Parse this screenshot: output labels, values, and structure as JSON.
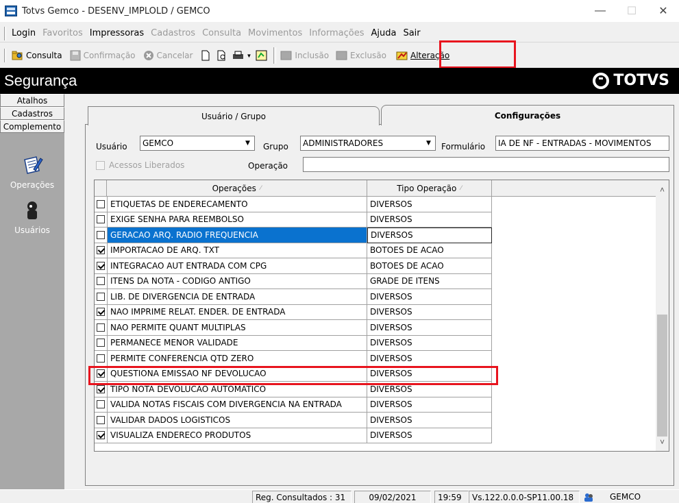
{
  "window": {
    "title": "Totvs Gemco - DESENV_IMPLOLD / GEMCO",
    "minimize": "—",
    "maximize": "☐",
    "close": "✕"
  },
  "menu": [
    {
      "label": "Login",
      "enabled": true
    },
    {
      "label": "Favoritos",
      "enabled": false
    },
    {
      "label": "Impressoras",
      "enabled": true
    },
    {
      "label": "Cadastros",
      "enabled": false
    },
    {
      "label": "Consulta",
      "enabled": false
    },
    {
      "label": "Movimentos",
      "enabled": false
    },
    {
      "label": "Informações",
      "enabled": false
    },
    {
      "label": "Ajuda",
      "enabled": true
    },
    {
      "label": "Sair",
      "enabled": true
    }
  ],
  "toolbar": {
    "consulta": "Consulta",
    "confirmacao": "Confirmação",
    "cancelar": "Cancelar",
    "inclusao": "Inclusão",
    "exclusao": "Exclusão",
    "alteracao": "Alteração"
  },
  "header": {
    "title": "Segurança",
    "logo": "TOTVS"
  },
  "sidebar": {
    "tabs": [
      "Atalhos",
      "Cadastros",
      "Complemento"
    ],
    "entries": [
      "Operações",
      "Usuários"
    ]
  },
  "tabs": {
    "usuario_grupo": "Usuário  / Grupo",
    "configuracoes": "Configurações"
  },
  "form": {
    "usuario_label": "Usuário",
    "usuario_value": "GEMCO",
    "grupo_label": "Grupo",
    "grupo_value": "ADMINISTRADORES",
    "formulario_label": "Formulário",
    "formulario_value": "IA DE NF - ENTRADAS - MOVIMENTOS",
    "acessos_label": "Acessos Liberados",
    "operacao_label": "Operação",
    "operacao_value": ""
  },
  "grid": {
    "col_operacoes": "Operações",
    "col_tipo": "Tipo Operação",
    "rows": [
      {
        "checked": false,
        "op": "ETIQUETAS DE ENDERECAMENTO",
        "tipo": "DIVERSOS"
      },
      {
        "checked": false,
        "op": "EXIGE SENHA PARA REEMBOLSO",
        "tipo": "DIVERSOS"
      },
      {
        "checked": false,
        "op": "GERACAO ARQ. RADIO FREQUENCIA",
        "tipo": "DIVERSOS",
        "selected": true
      },
      {
        "checked": true,
        "op": "IMPORTACAO DE ARQ. TXT",
        "tipo": "BOTOES DE ACAO"
      },
      {
        "checked": true,
        "op": "INTEGRACAO AUT ENTRADA COM CPG",
        "tipo": "BOTOES DE ACAO"
      },
      {
        "checked": false,
        "op": "ITENS DA NOTA - CODIGO ANTIGO",
        "tipo": "GRADE DE ITENS"
      },
      {
        "checked": false,
        "op": "LIB. DE DIVERGENCIA DE ENTRADA",
        "tipo": "DIVERSOS"
      },
      {
        "checked": true,
        "op": "NAO IMPRIME RELAT. ENDER. DE ENTRADA",
        "tipo": "DIVERSOS"
      },
      {
        "checked": false,
        "op": "NAO PERMITE QUANT MULTIPLAS",
        "tipo": "DIVERSOS"
      },
      {
        "checked": false,
        "op": "PERMANECE MENOR VALIDADE",
        "tipo": "DIVERSOS"
      },
      {
        "checked": false,
        "op": "PERMITE CONFERENCIA QTD ZERO",
        "tipo": "DIVERSOS"
      },
      {
        "checked": true,
        "op": "QUESTIONA EMISSAO NF DEVOLUCAO",
        "tipo": "DIVERSOS"
      },
      {
        "checked": true,
        "op": "TIPO NOTA DEVOLUCAO AUTOMATICO",
        "tipo": "DIVERSOS"
      },
      {
        "checked": false,
        "op": "VALIDA NOTAS FISCAIS COM DIVERGENCIA NA ENTRADA",
        "tipo": "DIVERSOS"
      },
      {
        "checked": false,
        "op": "VALIDAR DADOS LOGISTICOS",
        "tipo": "DIVERSOS"
      },
      {
        "checked": true,
        "op": "VISUALIZA ENDERECO PRODUTOS",
        "tipo": "DIVERSOS"
      }
    ]
  },
  "status": {
    "reg": "Reg. Consultados : 31",
    "date": "09/02/2021",
    "time": "19:59",
    "version": "Vs.122.0.0.0-SP11.00.18",
    "user": "GEMCO"
  }
}
